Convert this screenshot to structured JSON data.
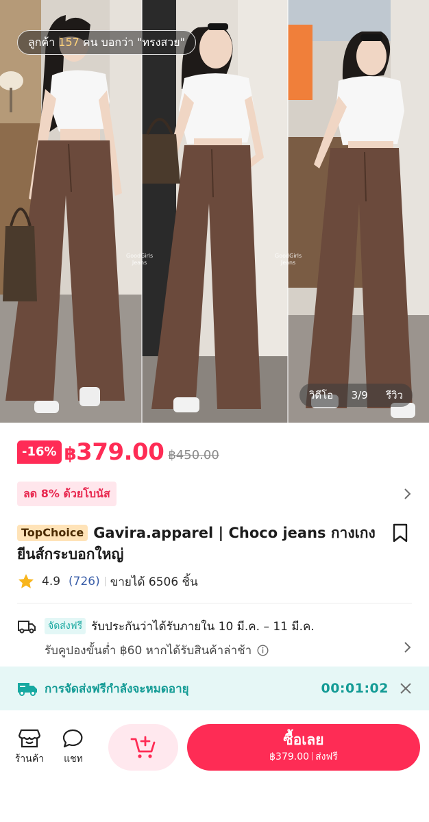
{
  "gallery": {
    "review_pill": {
      "prefix": "ลูกค้า",
      "count": "157",
      "suffix": "คน บอกว่า \"ทรงสวย\""
    },
    "watermark": {
      "line1": "GoodGirls",
      "line2": "Jeans"
    },
    "tabs": {
      "video": "วิดีโอ",
      "position": "3/9",
      "review": "รีวิว"
    },
    "colors": {
      "jeans": "#6b4a3c",
      "top": "#f7f7f7",
      "wall": "#d8d2ca"
    }
  },
  "price": {
    "discount": "-16%",
    "currency": "฿",
    "current": "379.00",
    "original": "฿450.00",
    "accent": "#fe2c55"
  },
  "bonus": {
    "label": "ลด 8% ด้วยโบนัส"
  },
  "product": {
    "badge": "TopChoice",
    "title": "Gavira.apparel | Choco jeans กางเกงยีนส์กระบอกใหญ่",
    "rating": "4.9",
    "review_count": "(726)",
    "sold": "ขายได้ 6506 ชิ้น"
  },
  "shipping": {
    "free_tag": "จัดส่งฟรี",
    "guarantee": "รับประกันว่าได้รับภายใน 10 มี.ค. – 11 มี.ค.",
    "coupon": "รับคูปองขั้นต่ำ ฿60 หากได้รับสินค้าล่าช้า"
  },
  "expire_banner": {
    "text": "การจัดส่งฟรีกำลังจะหมดอายุ",
    "timer": "00:01:02",
    "accent": "#139b95"
  },
  "bottom_bar": {
    "shop_label": "ร้านค้า",
    "chat_label": "แชท",
    "buy_label": "ซื้อเลย",
    "buy_price": "฿379.00",
    "buy_shipping": "ส่งฟรี"
  }
}
